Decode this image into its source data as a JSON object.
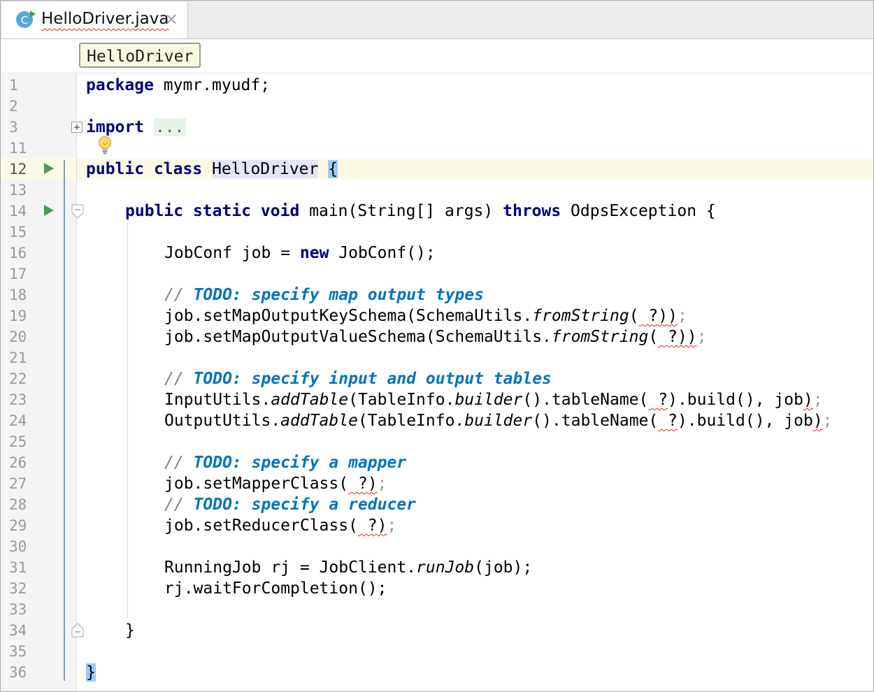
{
  "tab": {
    "title": "HelloDriver.java",
    "icon_letter": "C",
    "close": "×"
  },
  "breadcrumb": {
    "label": "HelloDriver"
  },
  "line_numbers": [
    "1",
    "2",
    "3",
    "11",
    "12",
    "13",
    "14",
    "15",
    "16",
    "17",
    "18",
    "19",
    "20",
    "21",
    "22",
    "23",
    "24",
    "25",
    "26",
    "27",
    "28",
    "29",
    "30",
    "31",
    "32",
    "33",
    "34",
    "35",
    "36"
  ],
  "code": {
    "l1": {
      "kw": "package",
      "rest": " mymr.myudf;"
    },
    "l3": {
      "kw": "import",
      "placeholder": "..."
    },
    "l12": {
      "kw1": "public",
      "kw2": "class",
      "name": "HelloDriver",
      "brace": "{"
    },
    "l14": {
      "kw1": "public",
      "kw2": "static",
      "kw3": "void",
      "sig": " main(String[] args) ",
      "kw4": "throws",
      "exc": " OdpsException {"
    },
    "l16": {
      "a": "JobConf job = ",
      "kw": "new",
      "b": " JobConf();"
    },
    "l18": {
      "slashes": "// ",
      "todo": "TODO: specify map output types"
    },
    "l19": {
      "a": "job.setMapOutputKeySchema(SchemaUtils.",
      "m": "fromString",
      "b": "(",
      "q": " ?",
      "c": "))",
      "d": ";"
    },
    "l20": {
      "a": "job.setMapOutputValueSchema(SchemaUtils.",
      "m": "fromString",
      "b": "(",
      "q": " ?",
      "c": "))",
      "d": ";"
    },
    "l22": {
      "slashes": "// ",
      "todo": "TODO: specify input and output tables"
    },
    "l23": {
      "a": "InputUtils.",
      "m1": "addTable",
      "b": "(TableInfo.",
      "m2": "builder",
      "c": "().tableName(",
      "q": " ?",
      "d": ").build(), job",
      "e": ")",
      "f": ";"
    },
    "l24": {
      "a": "OutputUtils.",
      "m1": "addTable",
      "b": "(TableInfo.",
      "m2": "builder",
      "c": "().tableName(",
      "q": " ?",
      "d": ").build(), job",
      "e": ")",
      "f": ";"
    },
    "l26": {
      "slashes": "// ",
      "todo": "TODO: specify a mapper"
    },
    "l27": {
      "a": "job.setMapperClass(",
      "q": " ?",
      "b": ")",
      "c": ";"
    },
    "l28": {
      "slashes": "// ",
      "todo": "TODO: specify a reducer"
    },
    "l29": {
      "a": "job.setReducerClass(",
      "q": " ?",
      "b": ")",
      "c": ";"
    },
    "l31": {
      "a": "RunningJob rj = JobClient.",
      "m": "runJob",
      "b": "(job);"
    },
    "l32": {
      "a": "rj.waitForCompletion();"
    },
    "l34": {
      "a": "}"
    },
    "l36": {
      "a": "}"
    }
  },
  "colors": {
    "keyword": "#000080",
    "todo": "#0073bf",
    "comment": "#808080",
    "error_squiggle": "#e0281c",
    "run_icon": "#499c54",
    "caret_row": "#fcfae4"
  },
  "icons": {
    "tab": "java-class-icon",
    "run": "run-gutter-icon",
    "bulb": "intention-bulb-icon"
  }
}
